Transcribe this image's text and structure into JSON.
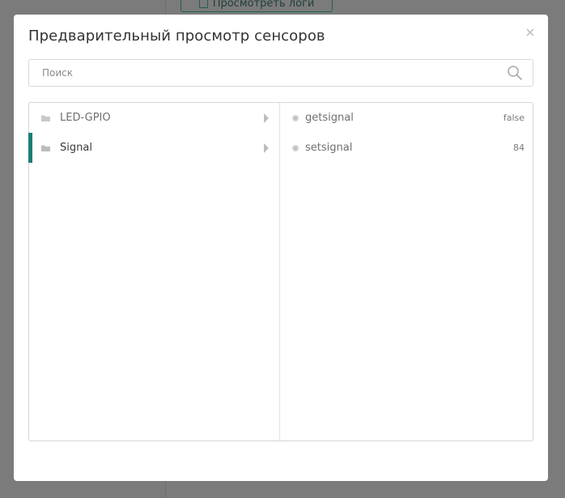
{
  "background": {
    "logs_button_label": "Просмотреть логи"
  },
  "modal": {
    "title": "Предварительный просмотр сенсоров",
    "search": {
      "placeholder": "Поиск",
      "value": ""
    },
    "groups": [
      {
        "label": "LED-GPIO",
        "active": false
      },
      {
        "label": "Signal",
        "active": true
      }
    ],
    "sensors": [
      {
        "name": "getsignal",
        "value": "false"
      },
      {
        "name": "setsignal",
        "value": "84"
      }
    ]
  },
  "colors": {
    "overlay": "#7b7b7b",
    "accent": "#1a7f74",
    "modal_bg": "#ffffff",
    "border": "#d6d6d6"
  },
  "icons": {
    "close": "close-icon",
    "search": "search-icon",
    "folder": "folder-icon",
    "chevron": "chevron-right-icon",
    "sensor": "sensor-dot-icon"
  }
}
